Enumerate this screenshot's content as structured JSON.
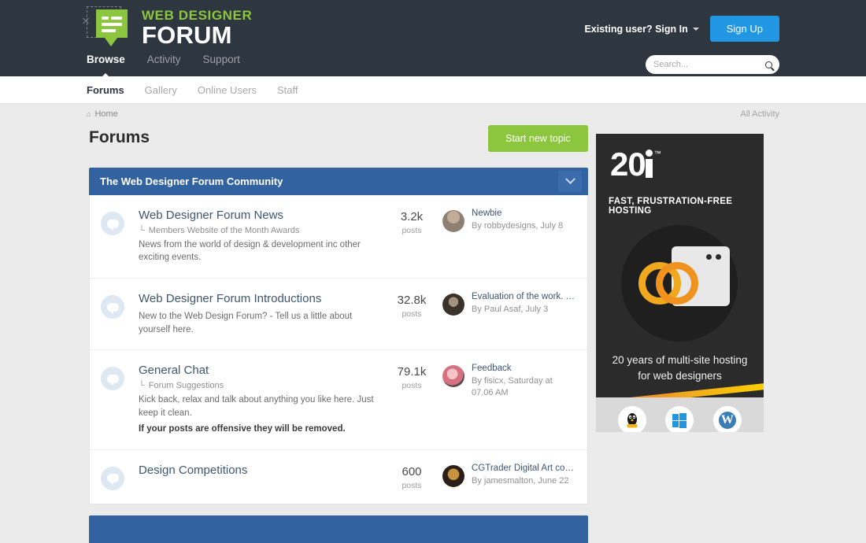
{
  "brand": {
    "line1": "WEB DESIGNER",
    "line2": "FORUM",
    "green": "#8cc63e"
  },
  "header": {
    "signin_label": "Existing user? Sign In",
    "signup_label": "Sign Up",
    "signup_color": "#2196e3",
    "nav": [
      {
        "label": "Browse",
        "active": true
      },
      {
        "label": "Activity",
        "active": false
      },
      {
        "label": "Support",
        "active": false
      }
    ],
    "search": {
      "placeholder": "Search...",
      "value": "",
      "icon": "search-icon"
    }
  },
  "subnav": [
    {
      "label": "Forums",
      "active": true
    },
    {
      "label": "Gallery",
      "active": false
    },
    {
      "label": "Online Users",
      "active": false
    },
    {
      "label": "Staff",
      "active": false
    }
  ],
  "breadcrumb": {
    "home_icon": "⌂",
    "home_label": "Home",
    "all_activity": "All Activity"
  },
  "page": {
    "title": "Forums",
    "new_topic_label": "Start new topic",
    "new_topic_color": "#8cc63e"
  },
  "categories": [
    {
      "title": "The Web Designer Forum Community",
      "header_color": "#32629f",
      "toggle_icon": "chevron-down-icon",
      "forums": [
        {
          "name": "Web Designer Forum News",
          "subforum_arrow": "└",
          "subforum": "Members Website of the Month Awards",
          "description": "News from the world of design & development inc other exciting events.",
          "description_bold": "",
          "posts_count": "3.2k",
          "posts_label": "posts",
          "last_title": "Newbie",
          "last_by": "By robbydesigns, July 8",
          "avatar_colors": [
            "#8d7f72",
            "#c9b9a6"
          ]
        },
        {
          "name": "Web Designer Forum Introductions",
          "subforum_arrow": "",
          "subforum": "",
          "description": "New to the Web Design Forum? - Tell us a little about yourself here.",
          "description_bold": "",
          "posts_count": "32.8k",
          "posts_label": "posts",
          "last_title": "Evaluation of the work. HT...",
          "last_by": "By Paul Asaf, July 3",
          "avatar_colors": [
            "#5a5248",
            "#2e2a24"
          ]
        },
        {
          "name": "General Chat",
          "subforum_arrow": "└",
          "subforum": "Forum Suggestions",
          "description": "Kick back, relax and talk about anything you like here. Just keep it clean.",
          "description_bold": "If your posts are offensive they will be removed.",
          "posts_count": "79.1k",
          "posts_label": "posts",
          "last_title": "Feedback",
          "last_by": "By fisicx, Saturday at 07.06 AM",
          "avatar_colors": [
            "#e8a0a8",
            "#b05a66"
          ]
        },
        {
          "name": "Design Competitions",
          "subforum_arrow": "",
          "subforum": "",
          "description": "",
          "description_bold": "",
          "posts_count": "600",
          "posts_label": "posts",
          "last_title": "CGTrader Digital Art comp...",
          "last_by": "By jamesmalton, June 22",
          "avatar_colors": [
            "#d6a03a",
            "#3a2c18"
          ]
        }
      ]
    }
  ],
  "ad": {
    "logo_num": "20",
    "logo_i": "i",
    "trademark": "™",
    "tagline": "FAST, FRUSTRATION-FREE HOSTING",
    "copy_line1": "20 years of multi-site hosting",
    "copy_line2": "for web designers",
    "accent_orange": "#f0921e",
    "platforms": [
      {
        "name": "linux-icon",
        "glyph": "🐧"
      },
      {
        "name": "windows-icon",
        "glyph": ""
      },
      {
        "name": "wordpress-icon",
        "glyph": "W"
      }
    ]
  }
}
